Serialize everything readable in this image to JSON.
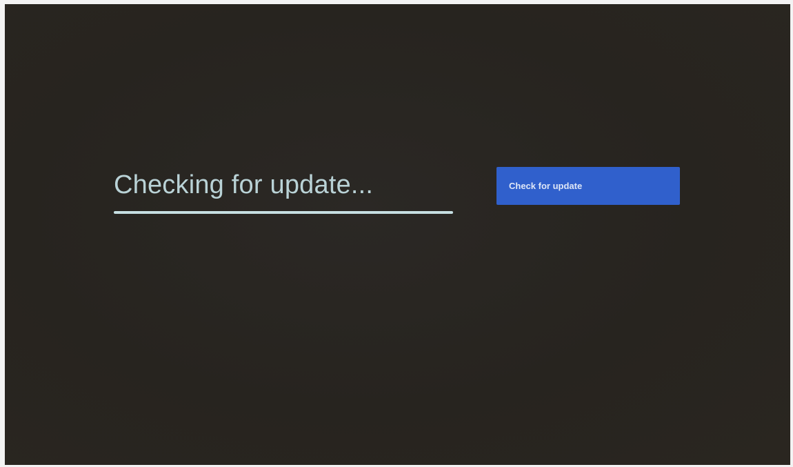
{
  "status": {
    "title": "Checking for update...",
    "progress": 1.0
  },
  "actions": {
    "check_label": "Check for update"
  },
  "colors": {
    "background": "#28251f",
    "title": "#b9d2d6",
    "progress": "#c6dfe2",
    "button": "#3060cc"
  }
}
